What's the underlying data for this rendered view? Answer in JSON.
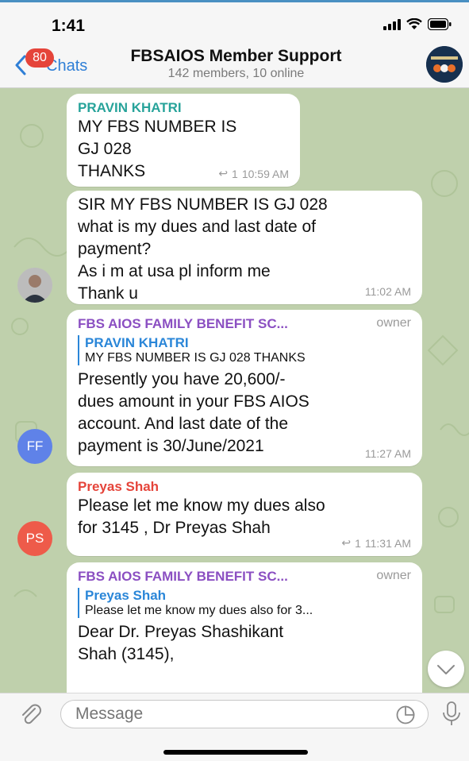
{
  "status_bar": {
    "time": "1:41"
  },
  "header": {
    "back_label": "Chats",
    "unread_badge": "80",
    "title": "FBSAIOS Member Support",
    "subtitle": "142 members, 10 online"
  },
  "messages": [
    {
      "sender": "PRAVIN KHATRI",
      "lines": [
        "MY FBS NUMBER IS",
        "GJ  028",
        "THANKS"
      ],
      "replies_count": "1",
      "time": "10:59 AM"
    },
    {
      "lines": [
        "SIR  MY FBS NUMBER IS GJ 028",
        "what is my dues and last date of",
        "payment?",
        "As i m at usa pl inform me",
        "Thank u"
      ],
      "time": "11:02 AM"
    },
    {
      "sender": "FBS AIOS FAMILY BENEFIT SC...",
      "role": "owner",
      "reply_to": {
        "name": "PRAVIN KHATRI",
        "text": "MY FBS NUMBER IS  GJ  028 THANKS"
      },
      "lines": [
        "Presently you have 20,600/-",
        "dues amount in your FBS AIOS",
        "account. And last date of the",
        "payment is 30/June/2021"
      ],
      "time": "11:27 AM",
      "avatar_initials": "FF"
    },
    {
      "sender": "Preyas Shah",
      "lines": [
        "Please let me know my dues also",
        "for 3145 , Dr Preyas Shah"
      ],
      "replies_count": "1",
      "time": "11:31 AM",
      "avatar_initials": "PS"
    },
    {
      "sender": "FBS AIOS FAMILY BENEFIT SC...",
      "role": "owner",
      "reply_to": {
        "name": "Preyas Shah",
        "text": "Please let me know my dues also for 3..."
      },
      "lines": [
        "Dear Dr. Preyas  Shashikant",
        "Shah (3145),"
      ]
    }
  ],
  "input": {
    "placeholder": "Message"
  },
  "colors": {
    "accent": "#2f7fd6",
    "badge": "#e5443a",
    "sender_green": "#27a39a",
    "sender_purple": "#8b4fc2",
    "sender_red": "#e5443a",
    "avatar_ff": "#5f82e8",
    "avatar_ps": "#ee5b4a"
  },
  "icons": [
    "back-chevron-icon",
    "signal-icon",
    "wifi-icon",
    "battery-icon",
    "reply-arrow-icon",
    "chevron-down-icon",
    "paperclip-icon",
    "sticker-icon",
    "microphone-icon"
  ]
}
